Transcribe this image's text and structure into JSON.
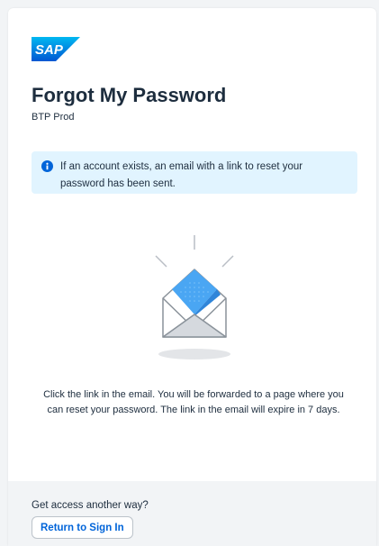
{
  "brand": {
    "logo_text": "SAP",
    "logo_color": "#0a6ed1"
  },
  "header": {
    "title": "Forgot My Password",
    "subtitle": "BTP Prod"
  },
  "info": {
    "icon": "info-circle-icon",
    "message": "If an account exists, an email with a link to reset your password has been sent.",
    "background": "#e1f4ff",
    "icon_color": "#0064d9"
  },
  "illustration": {
    "icon": "open-envelope-icon"
  },
  "description": "Click the link in the email. You will be forwarded to a page where you can reset your password. The link in the email will expire in 7 days.",
  "footer": {
    "alt_text": "Get access another way?",
    "return_label": "Return to Sign In",
    "link_color": "#0064d9"
  }
}
